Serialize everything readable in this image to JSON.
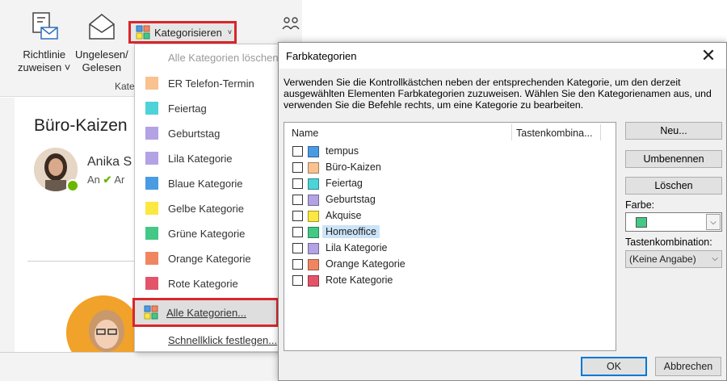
{
  "ribbon": {
    "richtlinie_line1": "Richtlinie",
    "richtlinie_line2": "zuweisen ˅",
    "ungelesen_line1": "Ungelesen/",
    "ungelesen_line2": "Gelesen",
    "kategorisieren": "Kategorisieren",
    "group_label": "Kate"
  },
  "email": {
    "subject": "Büro-Kaizen",
    "sender": "Anika S",
    "to_prefix": "An",
    "to_name": "Ar"
  },
  "menu": {
    "clear_all": "Alle Kategorien löschen",
    "items": [
      {
        "label": "ER Telefon-Termin",
        "color": "#f9c290"
      },
      {
        "label": "Feiertag",
        "color": "#4dd3d8"
      },
      {
        "label": "Geburtstag",
        "color": "#b3a2e4"
      },
      {
        "label": "Lila Kategorie",
        "color": "#b3a2e4"
      },
      {
        "label": "Blaue Kategorie",
        "color": "#4b9be2"
      },
      {
        "label": "Gelbe Kategorie",
        "color": "#fbe840"
      },
      {
        "label": "Grüne Kategorie",
        "color": "#43c886"
      },
      {
        "label": "Orange Kategorie",
        "color": "#f08661"
      },
      {
        "label": "Rote Kategorie",
        "color": "#e3546a"
      }
    ],
    "all_categories": "Alle Kategorien...",
    "quick_click": "Schnellklick festlegen..."
  },
  "dialog": {
    "title": "Farbkategorien",
    "instructions": "Verwenden Sie die Kontrollkästchen neben der entsprechenden Kategorie, um den derzeit ausgewählten Elementen Farbkategorien zuzuweisen. Wählen Sie den Kategorienamen aus, und verwenden Sie die Befehle rechts, um eine Kategorie zu bearbeiten.",
    "col_name": "Name",
    "col_shortcut": "Tastenkombina...",
    "categories": [
      {
        "label": "tempus",
        "color": "#4b9be2",
        "checked": false,
        "selected": false
      },
      {
        "label": "Büro-Kaizen",
        "color": "#f9c290",
        "checked": false,
        "selected": false
      },
      {
        "label": "Feiertag",
        "color": "#4dd3d8",
        "checked": false,
        "selected": false
      },
      {
        "label": "Geburtstag",
        "color": "#b3a2e4",
        "checked": false,
        "selected": false
      },
      {
        "label": "Akquise",
        "color": "#fbe840",
        "checked": false,
        "selected": false
      },
      {
        "label": "Homeoffice",
        "color": "#43c886",
        "checked": false,
        "selected": true
      },
      {
        "label": "Lila Kategorie",
        "color": "#b3a2e4",
        "checked": false,
        "selected": false
      },
      {
        "label": "Orange Kategorie",
        "color": "#f08661",
        "checked": false,
        "selected": false
      },
      {
        "label": "Rote Kategorie",
        "color": "#e3546a",
        "checked": false,
        "selected": false
      }
    ],
    "new_btn": "Neu...",
    "rename_btn": "Umbenennen",
    "delete_btn": "Löschen",
    "color_label": "Farbe:",
    "color_value": "#43c886",
    "shortcut_label": "Tastenkombination:",
    "shortcut_value": "(Keine Angabe)",
    "ok_btn": "OK",
    "cancel_btn": "Abbrechen"
  },
  "colors": {
    "highlight_red": "#d9262b",
    "selection_blue": "#cce4f7",
    "focus_blue": "#0078d7"
  }
}
